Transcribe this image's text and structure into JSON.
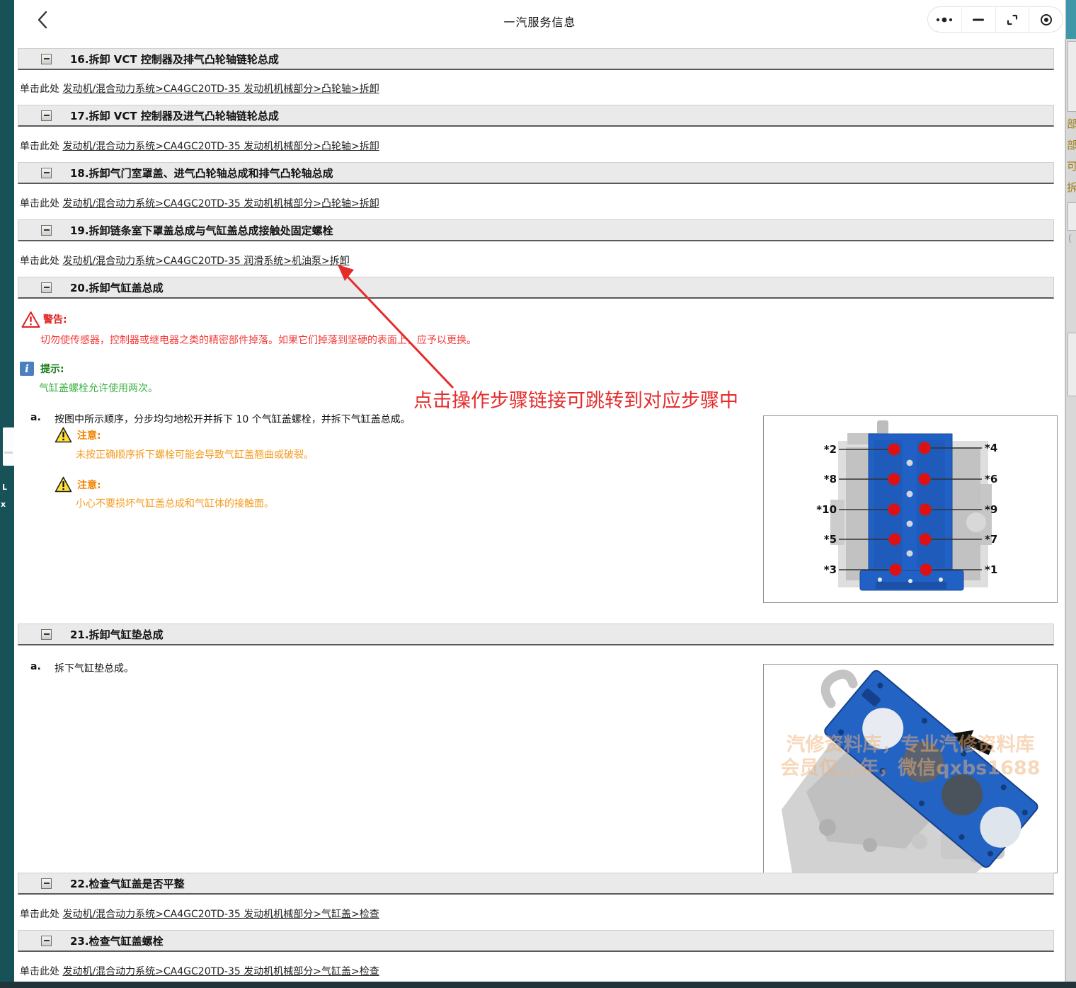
{
  "window": {
    "title": "一汽服务信息",
    "controls": [
      "more-icon",
      "minimize-icon",
      "fullscreen-icon",
      "record-icon"
    ]
  },
  "labels": {
    "click_here": "单击此处"
  },
  "sections": [
    {
      "title": "16.拆卸 VCT 控制器及排气凸轮轴链轮总成",
      "link_text": "发动机/混合动力系统>CA4GC20TD-35 发动机机械部分>凸轮轴>拆卸"
    },
    {
      "title": "17.拆卸 VCT 控制器及进气凸轮轴链轮总成",
      "link_text": "发动机/混合动力系统>CA4GC20TD-35 发动机机械部分>凸轮轴>拆卸"
    },
    {
      "title": "18.拆卸气门室罩盖、进气凸轮轴总成和排气凸轮轴总成",
      "link_text": "发动机/混合动力系统>CA4GC20TD-35 发动机机械部分>凸轮轴>拆卸"
    },
    {
      "title": "19.拆卸链条室下罩盖总成与气缸盖总成接触处固定螺栓",
      "link_text": "发动机/混合动力系统>CA4GC20TD-35 润滑系统>机油泵>拆卸"
    },
    {
      "title": "20.拆卸气缸盖总成"
    },
    {
      "title": "21.拆卸气缸垫总成"
    },
    {
      "title": "22.检查气缸盖是否平整",
      "link_text": "发动机/混合动力系统>CA4GC20TD-35 发动机机械部分>气缸盖>检查"
    },
    {
      "title": "23.检查气缸盖螺栓",
      "link_text": "发动机/混合动力系统>CA4GC20TD-35 发动机机械部分>气缸盖>检查"
    }
  ],
  "warning": {
    "label": "警告:",
    "text": "切勿使传感器，控制器或继电器之类的精密部件掉落。如果它们掉落到坚硬的表面上，应予以更换。"
  },
  "tip": {
    "label": "提示:",
    "text": "气缸盖螺栓允许使用两次。"
  },
  "step20": {
    "marker": "a.",
    "text": "按图中所示顺序，分步均匀地松开并拆下 10 个气缸盖螺栓，并拆下气缸盖总成。"
  },
  "cautions": [
    {
      "label": "注意:",
      "text": "未按正确顺序拆下螺栓可能会导致气缸盖翘曲或破裂。"
    },
    {
      "label": "注意:",
      "text": "小心不要损坏气缸盖总成和气缸体的接触面。"
    }
  ],
  "step21": {
    "marker": "a.",
    "text": "拆下气缸垫总成。"
  },
  "annotation": {
    "text": "点击操作步骤链接可跳转到对应步骤中"
  },
  "diagram1": {
    "description": "cylinder-head bolt loosening order, 10 bolts",
    "labels_left": [
      "*2",
      "*8",
      "*10",
      "*5",
      "*3"
    ],
    "labels_right": [
      "*4",
      "*6",
      "*9",
      "*7",
      "*1"
    ]
  },
  "diagram2": {
    "description": "head gasket removal",
    "watermark_line1": "汽修资料库，专业汽修资料库",
    "watermark_line2": "会员仅...年，微信qxbs1688"
  },
  "right_panel_fragments": [
    "部",
    "部",
    "可",
    "拆"
  ],
  "left_strip_fragments": {
    "line1": "L",
    "line2": "x"
  },
  "colors": {
    "edge_teal": "#175259",
    "edge_teal_light": "#3e98a8",
    "bottom_bar": "#20343a",
    "section_header_bg": "#eaeaea",
    "warning_red": "#df1f1f",
    "caution_orange": "#ef8200",
    "tip_green": "#3bb143",
    "annotation_red": "#e62b2b",
    "engine_blue": "#2160c4",
    "bolt_red": "#dd1111"
  }
}
